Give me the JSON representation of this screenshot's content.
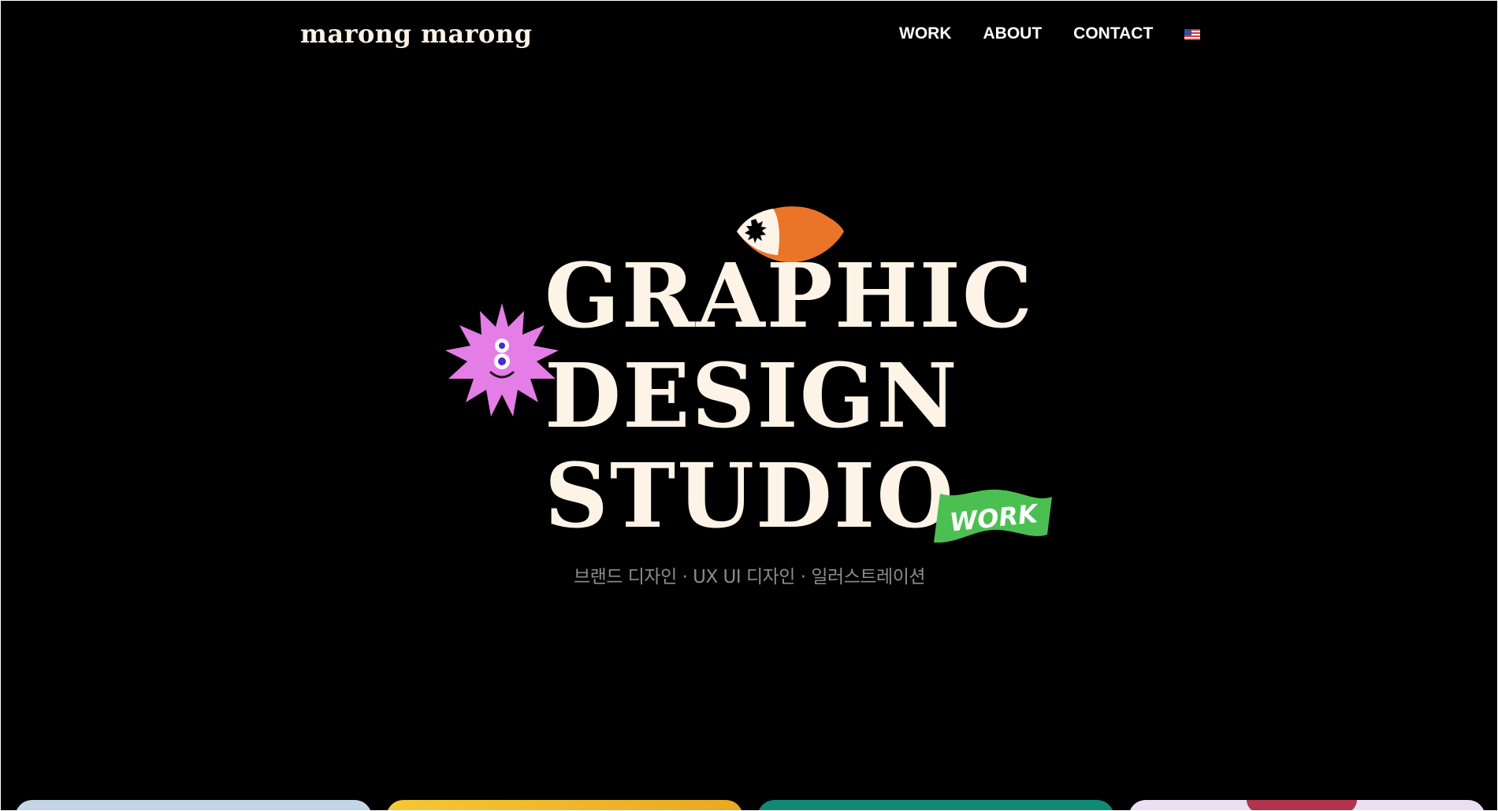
{
  "header": {
    "logo": "marong marong",
    "nav": [
      {
        "label": "WORK"
      },
      {
        "label": "ABOUT"
      },
      {
        "label": "CONTACT"
      }
    ],
    "language_icon": "us-flag-icon"
  },
  "hero": {
    "title_lines": [
      "GRAPHIC",
      "DESIGN",
      "STUDIO"
    ],
    "subtitle": "브랜드 디자인 · UX UI 디자인 · 일러스트레이션",
    "work_badge": "WORK"
  },
  "colors": {
    "background": "#000000",
    "title": "#fdf3e7",
    "eye": "#ea7528",
    "star": "#e57de6",
    "badge": "#4cbf52",
    "card_1": "#c3d6e8",
    "card_2": "#f3bd2b",
    "card_3": "#0f8a76",
    "card_4": "#eadff4"
  }
}
